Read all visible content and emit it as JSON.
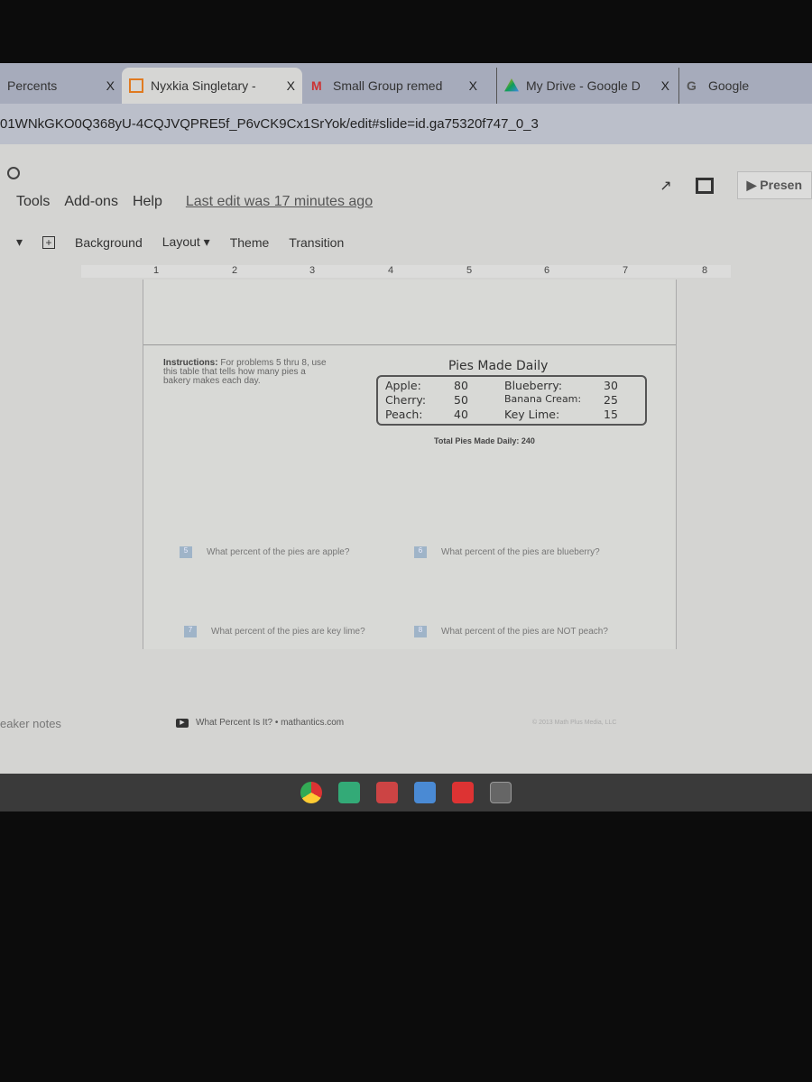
{
  "tabs": [
    {
      "label": "Percents",
      "active": false
    },
    {
      "label": "Nyxkia Singletary -",
      "active": true
    },
    {
      "label": "Small Group remed",
      "active": false
    },
    {
      "label": "My Drive - Google D",
      "active": false
    },
    {
      "label": "Google",
      "active": false
    }
  ],
  "tab_close": "X",
  "url": "01WNkGKO0Q368yU-4CQJVQPRE5f_P6vCK9Cx1SrYok/edit#slide=id.ga75320f747_0_3",
  "menu": {
    "items": [
      "Tools",
      "Add-ons",
      "Help"
    ],
    "last_edit": "Last edit was 17 minutes ago"
  },
  "toolbar": {
    "items": [
      "Background",
      "Layout",
      "Theme",
      "Transition"
    ]
  },
  "present_label": "Presen",
  "ruler": [
    "1",
    "2",
    "3",
    "4",
    "5",
    "6",
    "7",
    "8"
  ],
  "slide": {
    "instructions_label": "Instructions:",
    "instructions": "For problems 5 thru 8, use this table that tells how many pies a bakery makes each day.",
    "table_title": "Pies Made Daily",
    "pies": [
      {
        "name": "Apple:",
        "count": "80"
      },
      {
        "name": "Cherry:",
        "count": "50"
      },
      {
        "name": "Peach:",
        "count": "40"
      },
      {
        "name": "Blueberry:",
        "count": "30"
      },
      {
        "name": "Banana Cream:",
        "count": "25"
      },
      {
        "name": "Key Lime:",
        "count": "15"
      }
    ],
    "total": "Total Pies Made Daily: 240",
    "questions": [
      {
        "num": "5",
        "text": "What percent of the pies are apple?"
      },
      {
        "num": "6",
        "text": "What percent of the pies are blueberry?"
      },
      {
        "num": "7",
        "text": "What percent of the pies are key lime?"
      },
      {
        "num": "8",
        "text": "What percent of the pies are NOT peach?"
      }
    ],
    "footer": "What Percent Is It? • mathantics.com",
    "copyright": "© 2013 Math Plus Media, LLC"
  },
  "speaker_notes": "eaker notes"
}
